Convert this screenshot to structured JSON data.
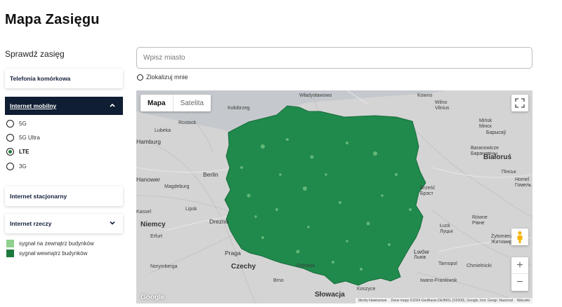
{
  "page": {
    "title": "Mapa Zasięgu"
  },
  "sidebar": {
    "heading": "Sprawdź zasięg",
    "sections": [
      {
        "label": "Telefonia komórkowa"
      },
      {
        "label": "Internet mobilny"
      },
      {
        "label": "Internet stacjonarny"
      },
      {
        "label": "Internet rzeczy"
      }
    ],
    "technologies": [
      {
        "label": "5G",
        "selected": false
      },
      {
        "label": "5G Ultra",
        "selected": false
      },
      {
        "label": "LTE",
        "selected": true
      },
      {
        "label": "3G",
        "selected": false
      }
    ],
    "legend": [
      {
        "label": "sygnał na zewnątrz budynków",
        "color": "#8fd08f"
      },
      {
        "label": "sygnał wewnątrz budynków",
        "color": "#1d7a3e"
      }
    ]
  },
  "search": {
    "placeholder": "Wpisz miasto",
    "value": ""
  },
  "locate": {
    "label": "Zlokalizuj mnie"
  },
  "map": {
    "type_buttons": [
      "Mapa",
      "Satelita"
    ],
    "zoom_in": "+",
    "zoom_out": "−",
    "google_logo": "Google",
    "attribution": [
      "Skróty klawiszowe",
      "Dane mapy ©2024 GeoBasis-DE/BKG (©2009), Google, Inst. Geogr. Nacional",
      "Warunki"
    ],
    "coverage_color": "#1f8a4c",
    "labels": [
      {
        "text": "Kowno"
      },
      {
        "text": "Wilno"
      },
      {
        "text": "Vilnius"
      },
      {
        "text": "Mińsk"
      },
      {
        "text": "Мінск"
      },
      {
        "text": "Барысаў"
      },
      {
        "text": "Białoruś"
      },
      {
        "text": "Brześć"
      },
      {
        "text": "Бpэcт"
      },
      {
        "text": "Baranowicze"
      },
      {
        "text": "Барaнавічы"
      },
      {
        "text": "Homel"
      },
      {
        "text": "Гомель"
      },
      {
        "text": "Łuck"
      },
      {
        "text": "Луцьк"
      },
      {
        "text": "Równe"
      },
      {
        "text": "Рівне"
      },
      {
        "text": "Żytomierz"
      },
      {
        "text": "Житомир"
      },
      {
        "text": "Lwów"
      },
      {
        "text": "Львів"
      },
      {
        "text": "Tarnopol"
      },
      {
        "text": "Chmielnicki"
      },
      {
        "text": "Iwano-Frankiwsk"
      },
      {
        "text": "Пінськ"
      },
      {
        "text": "Władysławowo"
      },
      {
        "text": "Kołobrzeg"
      },
      {
        "text": "Rostock"
      },
      {
        "text": "Lubeka"
      },
      {
        "text": "Hamburg"
      },
      {
        "text": "Berlin"
      },
      {
        "text": "Hanower"
      },
      {
        "text": "Magdeburg"
      },
      {
        "text": "Lipsk"
      },
      {
        "text": "Drezno"
      },
      {
        "text": "Niemcy"
      },
      {
        "text": "Praga"
      },
      {
        "text": "Norymberga"
      },
      {
        "text": "Czechy"
      },
      {
        "text": "Ostrawa"
      },
      {
        "text": "Brno"
      },
      {
        "text": "Słowacja"
      },
      {
        "text": "Koszyce"
      },
      {
        "text": "Kassel"
      },
      {
        "text": "Erfurt"
      }
    ]
  }
}
